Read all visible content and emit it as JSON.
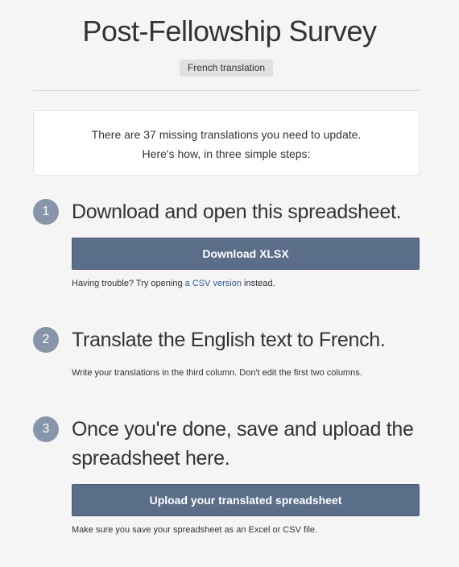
{
  "page_title": "Post-Fellowship Survey",
  "badge": "French translation",
  "info": {
    "line1": "There are 37 missing translations you need to update.",
    "line2": "Here's how, in three simple steps:"
  },
  "steps": [
    {
      "number": "1",
      "heading": "Download and open this spreadsheet.",
      "button": "Download XLSX",
      "note_before": "Having trouble? Try opening ",
      "note_link": "a CSV version",
      "note_after": " instead."
    },
    {
      "number": "2",
      "heading": "Translate the English text to French.",
      "note": "Write your translations in the third column. Don't edit the first two columns."
    },
    {
      "number": "3",
      "heading": "Once you're done, save and upload the spreadsheet here.",
      "button": "Upload your translated spreadsheet",
      "note": "Make sure you save your spreadsheet as an Excel or CSV file."
    }
  ]
}
